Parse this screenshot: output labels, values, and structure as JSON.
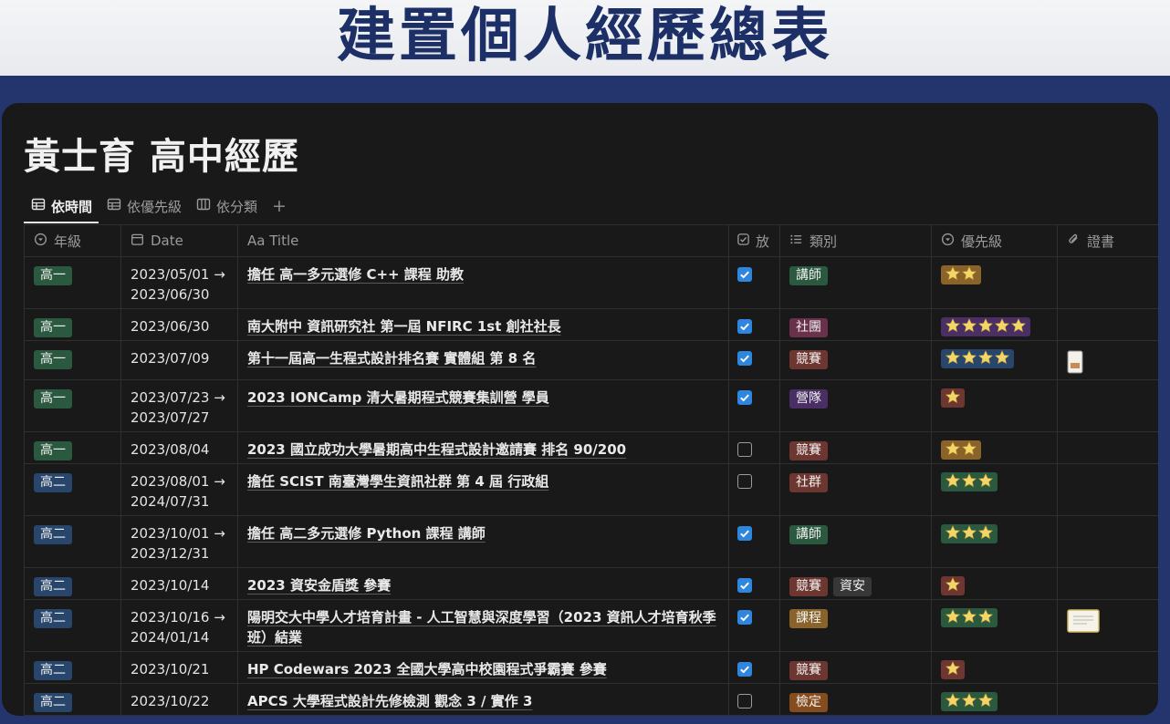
{
  "banner": {
    "title": "建置個人經歷總表"
  },
  "page": {
    "title": "黃士育 高中經歷"
  },
  "views": [
    {
      "label": "依時間",
      "icon": "table-icon",
      "active": true
    },
    {
      "label": "依優先級",
      "icon": "table-icon",
      "active": false
    },
    {
      "label": "依分類",
      "icon": "board-icon",
      "active": false
    }
  ],
  "add_view_label": "+",
  "columns": {
    "grade": "年級",
    "date": "Date",
    "title": "Aa Title",
    "done": "放",
    "category": "類別",
    "priority": "優先級",
    "cert": "證書"
  },
  "colors": {
    "accent_blue": "#2e86de",
    "banner_navy": "#1c2f66",
    "panel_bg": "#191919",
    "star_gold": "#f3d56a"
  },
  "rows": [
    {
      "grade": "高一",
      "date1": "2023/05/01 →",
      "date2": "2023/06/30",
      "title": "擔任 高一多元選修 C++ 課程 助教",
      "checked": true,
      "cats": [
        "講師"
      ],
      "stars": 2,
      "cert": false
    },
    {
      "grade": "高一",
      "date1": "2023/06/30",
      "date2": "",
      "title": "南大附中 資訊研究社 第一屆 NFIRC 1st 創社社長",
      "checked": true,
      "cats": [
        "社團"
      ],
      "stars": 5,
      "cert": false
    },
    {
      "grade": "高一",
      "date1": "2023/07/09",
      "date2": "",
      "title": "第十一屆高一生程式設計排名賽 實體組 第 8 名",
      "checked": true,
      "cats": [
        "競賽"
      ],
      "stars": 4,
      "cert": true
    },
    {
      "grade": "高一",
      "date1": "2023/07/23 →",
      "date2": "2023/07/27",
      "title": "2023 IONCamp 清大暑期程式競賽集訓營 學員",
      "checked": true,
      "cats": [
        "營隊"
      ],
      "stars": 1,
      "cert": false
    },
    {
      "grade": "高一",
      "date1": "2023/08/04",
      "date2": "",
      "title": "2023 國立成功大學暑期高中生程式設計邀請賽 排名 90/200",
      "checked": false,
      "cats": [
        "競賽"
      ],
      "stars": 2,
      "cert": false
    },
    {
      "grade": "高二",
      "date1": "2023/08/01 →",
      "date2": "2024/07/31",
      "title": "擔任 SCIST 南臺灣學生資訊社群 第 4 屆 行政組",
      "checked": false,
      "cats": [
        "社群"
      ],
      "stars": 3,
      "cert": false
    },
    {
      "grade": "高二",
      "date1": "2023/10/01 →",
      "date2": "2023/12/31",
      "title": "擔任 高二多元選修 Python 課程 講師",
      "checked": true,
      "cats": [
        "講師"
      ],
      "stars": 3,
      "cert": false
    },
    {
      "grade": "高二",
      "date1": "2023/10/14",
      "date2": "",
      "title": "2023 資安金盾獎 參賽",
      "checked": true,
      "cats": [
        "競賽",
        "資安"
      ],
      "stars": 1,
      "cert": false
    },
    {
      "grade": "高二",
      "date1": "2023/10/16 →",
      "date2": "2024/01/14",
      "title": "陽明交大中學人才培育計畫 - 人工智慧與深度學習（2023 資訊人才培育秋季",
      "title2": "班）結業",
      "checked": true,
      "cats": [
        "課程"
      ],
      "stars": 3,
      "cert": true
    },
    {
      "grade": "高二",
      "date1": "2023/10/21",
      "date2": "",
      "title": "HP Codewars 2023 全國大學高中校園程式爭霸賽 參賽",
      "checked": true,
      "cats": [
        "競賽"
      ],
      "stars": 1,
      "cert": false
    },
    {
      "grade": "高二",
      "date1": "2023/10/22",
      "date2": "",
      "title": "APCS 大學程式設計先修檢測 觀念 3 / 實作 3",
      "checked": false,
      "cats": [
        "檢定"
      ],
      "stars": 3,
      "cert": false
    }
  ]
}
